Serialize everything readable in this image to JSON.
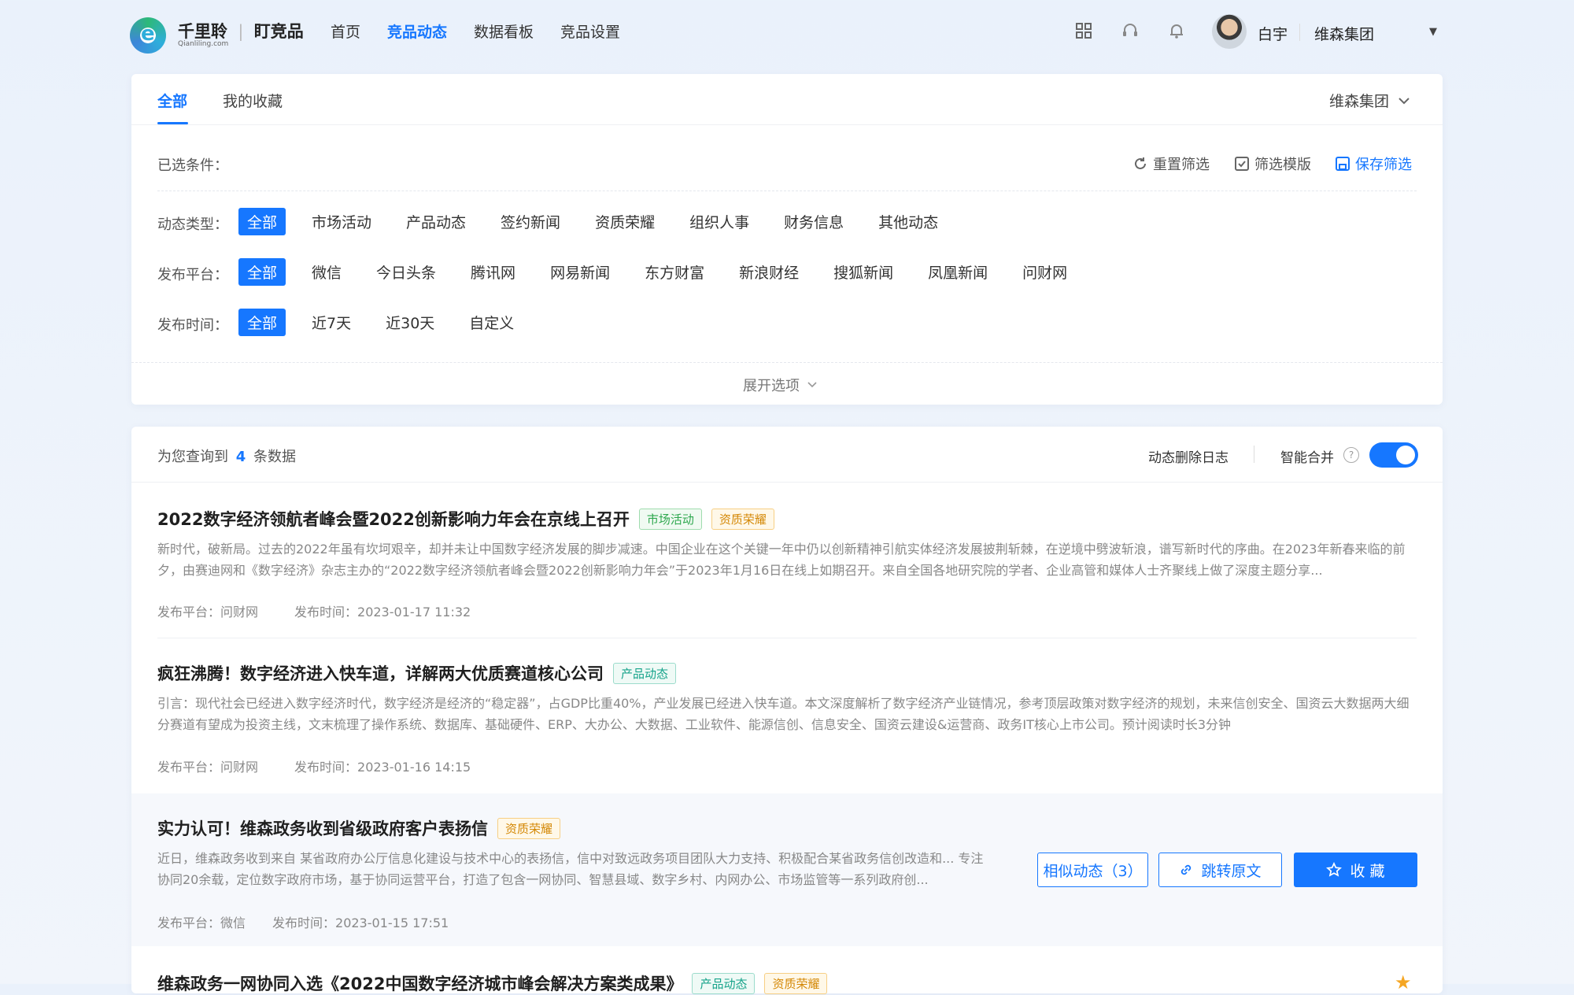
{
  "brand": {
    "name": "千里聆",
    "product": "盯竞品",
    "domain": "Qianliling.com"
  },
  "nav": [
    "首页",
    "竞品动态",
    "数据看板",
    "竞品设置"
  ],
  "nav_active": 1,
  "user": {
    "name": "白宇",
    "org": "维森集团"
  },
  "tabs": {
    "all": "全部",
    "fav": "我的收藏",
    "org_select": "维森集团"
  },
  "filters": {
    "selected_label": "已选条件：",
    "reset": "重置筛选",
    "template": "筛选模版",
    "save": "保存筛选",
    "type": {
      "label": "动态类型：",
      "options": [
        "全部",
        "市场活动",
        "产品动态",
        "签约新闻",
        "资质荣耀",
        "组织人事",
        "财务信息",
        "其他动态"
      ]
    },
    "platform": {
      "label": "发布平台：",
      "options": [
        "全部",
        "微信",
        "今日头条",
        "腾讯网",
        "网易新闻",
        "东方财富",
        "新浪财经",
        "搜狐新闻",
        "凤凰新闻",
        "问财网"
      ]
    },
    "time": {
      "label": "发布时间：",
      "options": [
        "全部",
        "近7天",
        "近30天",
        "自定义"
      ]
    },
    "expand": "展开选项"
  },
  "results": {
    "prefix": "为您查询到",
    "count": "4",
    "suffix": "条数据",
    "delete_log": "动态删除日志",
    "smart_merge": "智能合并",
    "smart_merge_on": true
  },
  "items": [
    {
      "title": "2022数字经济领航者峰会暨2022创新影响力年会在京线上召开",
      "tags": [
        "市场活动",
        "资质荣耀"
      ],
      "summary": "新时代，破新局。过去的2022年虽有坎坷艰辛，却并未让中国数字经济发展的脚步减速。中国企业在这个关键一年中仍以创新精神引航实体经济发展披荆斩棘，在逆境中劈波斩浪，谱写新时代的序曲。在2023年新春来临的前夕，由赛迪网和《数字经济》杂志主办的“2022数字经济领航者峰会暨2022创新影响力年会”于2023年1月16日在线上如期召开。来自全国各地研究院的学者、企业高管和媒体人士齐聚线上做了深度主题分享...",
      "platform": "发布平台：问财网",
      "time": "发布时间：2023-01-17 11:32"
    },
    {
      "title": "疯狂沸腾！数字经济进入快车道，详解两大优质赛道核心公司",
      "tags": [
        "产品动态"
      ],
      "summary": "引言：现代社会已经进入数字经济时代，数字经济是经济的“稳定器”，占GDP比重40%，产业发展已经进入快车道。本文深度解析了数字经济产业链情况，参考顶层政策对数字经济的规划，未来信创安全、国资云大数据两大细分赛道有望成为投资主线，文末梳理了操作系统、数据库、基础硬件、ERP、大办公、大数据、工业软件、能源信创、信息安全、国资云建设&运营商、政务IT核心上市公司。预计阅读时长3分钟",
      "platform": "发布平台：问财网",
      "time": "发布时间：2023-01-16 14:15"
    },
    {
      "title": "实力认可！维森政务收到省级政府客户表扬信",
      "tags": [
        "资质荣耀"
      ],
      "summary": "近日，维森政务收到来自 某省政府办公厅信息化建设与技术中心的表扬信，信中对致远政务项目团队大力支持、积极配合某省政务信创改造和... 专注协同20余载，定位数字政府市场，基于协同运营平台，打造了包含一网协同、智慧县域、数字乡村、内网办公、市场监管等一系列政府创...",
      "platform": "发布平台：微信",
      "time": "发布时间：2023-01-15 17:51",
      "actions": {
        "similar": "相似动态（3）",
        "jump": "跳转原文",
        "fav": "收 藏"
      }
    },
    {
      "title": "维森政务一网协同入选《2022中国数字经济城市峰会解决方案类成果》",
      "tags": [
        "产品动态",
        "资质荣耀"
      ]
    }
  ]
}
